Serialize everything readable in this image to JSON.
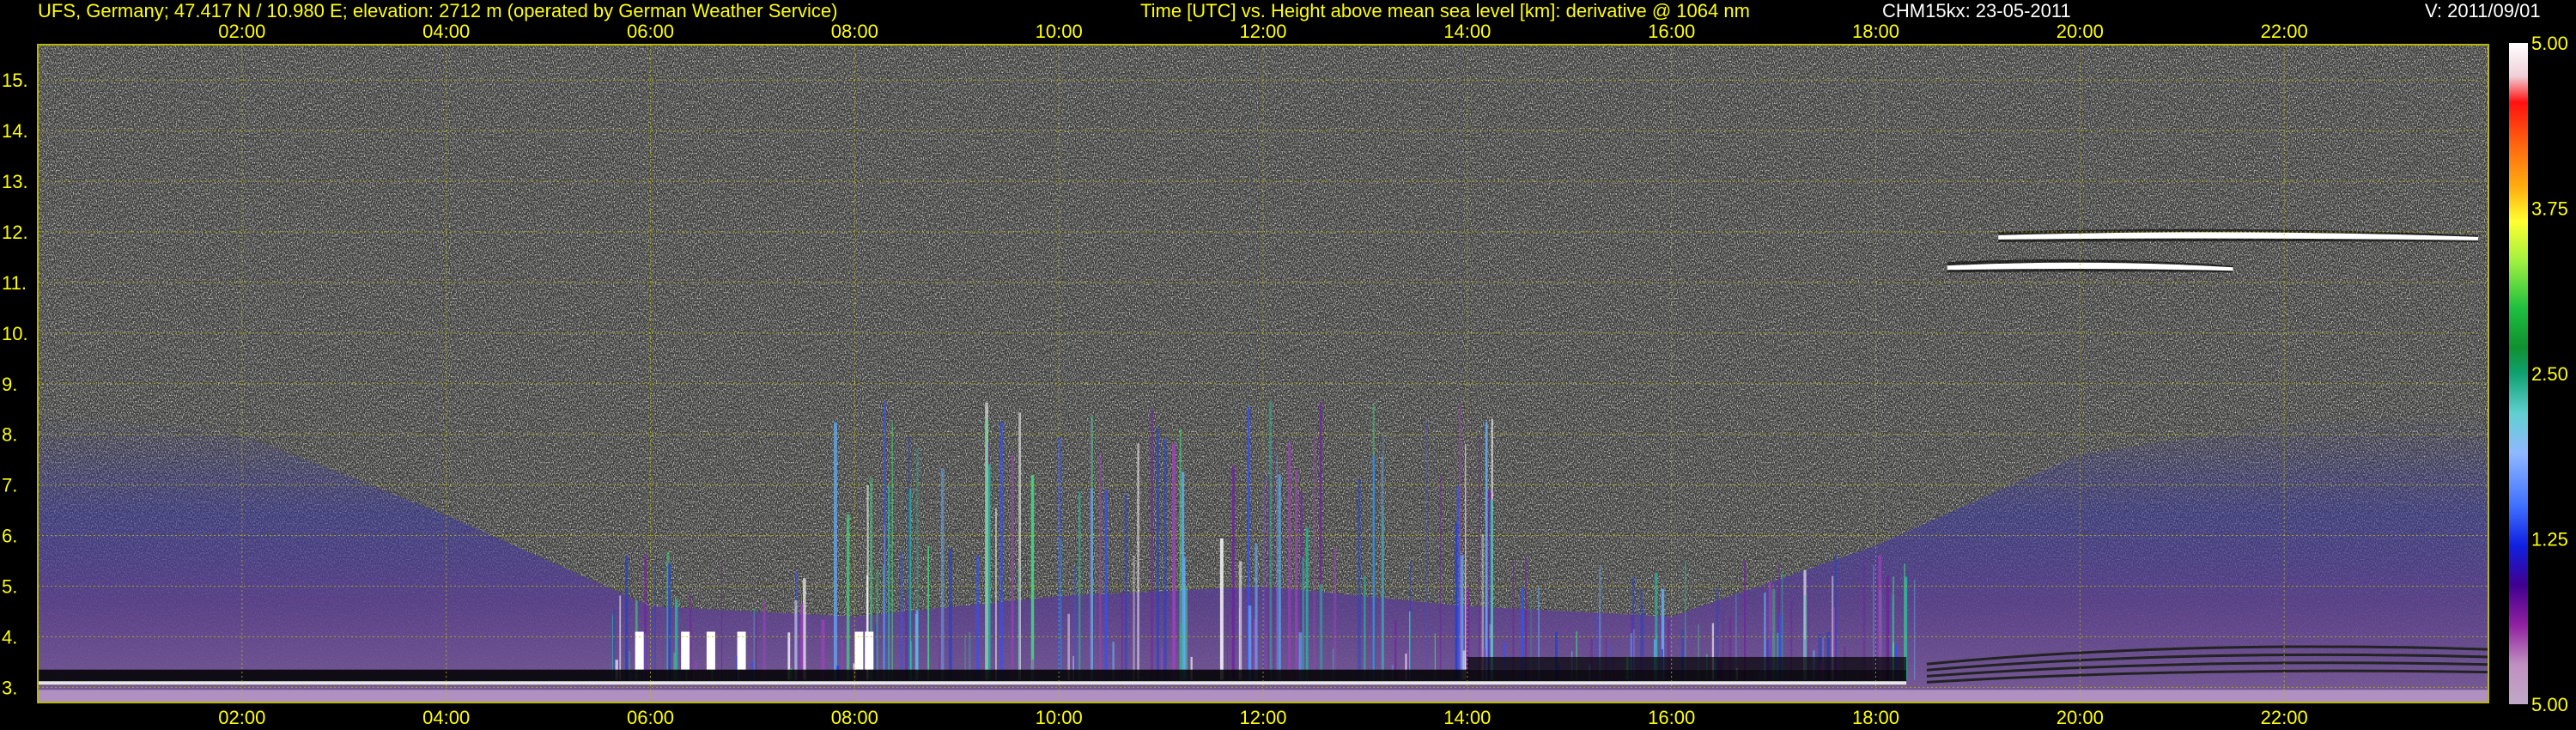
{
  "header": {
    "station": "UFS, Germany; 47.417 N / 10.980 E; elevation: 2712 m  (operated by German Weather Service)",
    "axis_desc": "Time [UTC] vs. Height above mean sea level [km]: derivative @ 1064 nm",
    "instrument": "CHM15kx: 23-05-2011",
    "version": "V: 2011/09/01"
  },
  "colors": {
    "text_yellow": "#ffff00",
    "grid": "#b8b800",
    "background": "#000000",
    "noise_light": "#d8d8d8",
    "noise_dark": "#555555",
    "aerosol_low": "#6b4b86",
    "aerosol_mid": "#4c4aa8",
    "boundary_layer": "#000000",
    "cloud": "#ffffff"
  },
  "chart_data": {
    "type": "heatmap",
    "title": "Time [UTC] vs. Height above mean sea level [km]: derivative @ 1064 nm",
    "xlabel": "Time [UTC]",
    "ylabel": "Height above mean sea level [km]",
    "x_ticks": [
      "02:00",
      "04:00",
      "06:00",
      "08:00",
      "10:00",
      "12:00",
      "14:00",
      "16:00",
      "18:00",
      "20:00",
      "22:00"
    ],
    "x_tick_hours": [
      2,
      4,
      6,
      8,
      10,
      12,
      14,
      16,
      18,
      20,
      22
    ],
    "xlim_hours": [
      0,
      24
    ],
    "y_ticks": [
      "3.",
      "4.",
      "5.",
      "6.",
      "7.",
      "8.",
      "9.",
      "10.",
      "11.",
      "12.",
      "13.",
      "14.",
      "15."
    ],
    "y_tick_values": [
      3,
      4,
      5,
      6,
      7,
      8,
      9,
      10,
      11,
      12,
      13,
      14,
      15
    ],
    "ylim_km": [
      2.7,
      15.7
    ],
    "grid": true,
    "colorbar": {
      "labels": [
        "5.00",
        "3.75",
        "2.50",
        "1.25",
        "5.00"
      ],
      "label_values": [
        5.0,
        3.75,
        2.5,
        1.25,
        0.0
      ],
      "position": "right",
      "colors": [
        "#ffffff",
        "#f0d0d8",
        "#ff1010",
        "#ff5010",
        "#ff8a10",
        "#ffc010",
        "#ffff30",
        "#c8ff30",
        "#60e060",
        "#20c040",
        "#10a020",
        "#108840",
        "#10a070",
        "#30c0a0",
        "#60d0d0",
        "#80b0ff",
        "#5090ff",
        "#2060ff",
        "#1020e0",
        "#2010b0",
        "#500090",
        "#8000a0",
        "#b050c0",
        "#c0a0c0"
      ]
    },
    "features": [
      {
        "name": "cloud layer",
        "time_start": 19.2,
        "time_end": 23.9,
        "height_km": 11.9
      },
      {
        "name": "cloud patch",
        "time_start": 18.7,
        "time_end": 21.5,
        "height_km": 11.3
      },
      {
        "name": "boundary layer top",
        "time_start": 0,
        "time_end": 18.3,
        "height_km": 3.2
      }
    ]
  }
}
